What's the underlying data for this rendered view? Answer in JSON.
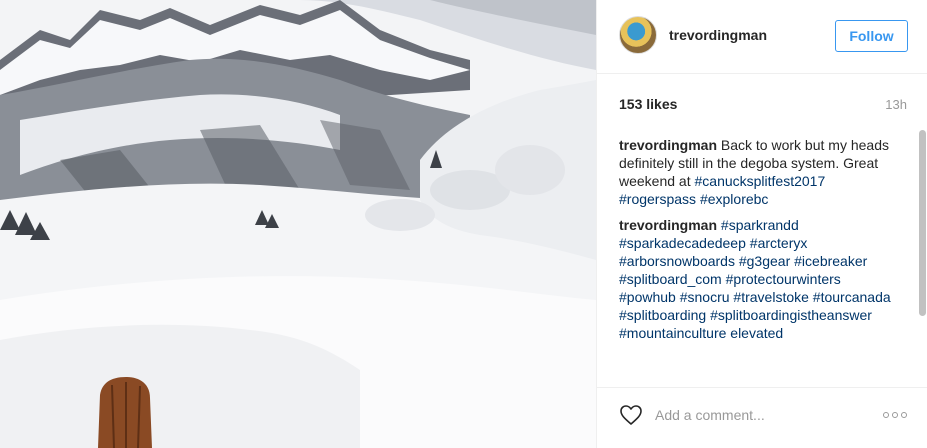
{
  "post": {
    "photo_alt": "",
    "author": {
      "username": "trevordingman",
      "avatar_icon": "avatar"
    },
    "follow_label": "Follow",
    "likes": "153 likes",
    "time_ago": "13h",
    "comments": [
      {
        "user": "trevordingman",
        "parts": [
          {
            "type": "text",
            "value": "Back to work but my heads definitely still in the degoba system. Great weekend at "
          },
          {
            "type": "tag",
            "value": "#canucksplitfest2017"
          },
          {
            "type": "text",
            "value": " "
          },
          {
            "type": "tag",
            "value": "#rogerspass"
          },
          {
            "type": "text",
            "value": " "
          },
          {
            "type": "tag",
            "value": "#explorebc"
          }
        ]
      },
      {
        "user": "trevordingman",
        "parts": [
          {
            "type": "tag",
            "value": "#sparkrandd"
          },
          {
            "type": "text",
            "value": " "
          },
          {
            "type": "tag",
            "value": "#sparkadecadedeep"
          },
          {
            "type": "text",
            "value": " "
          },
          {
            "type": "tag",
            "value": "#arcteryx"
          },
          {
            "type": "text",
            "value": " "
          },
          {
            "type": "tag",
            "value": "#arborsnowboards"
          },
          {
            "type": "text",
            "value": " "
          },
          {
            "type": "tag",
            "value": "#g3gear"
          },
          {
            "type": "text",
            "value": " "
          },
          {
            "type": "tag",
            "value": "#icebreaker"
          },
          {
            "type": "text",
            "value": " "
          },
          {
            "type": "tag",
            "value": "#splitboard_com"
          },
          {
            "type": "text",
            "value": " "
          },
          {
            "type": "tag",
            "value": "#protectourwinters"
          },
          {
            "type": "text",
            "value": " "
          },
          {
            "type": "tag",
            "value": "#powhub"
          },
          {
            "type": "text",
            "value": " "
          },
          {
            "type": "tag",
            "value": "#snocru"
          },
          {
            "type": "text",
            "value": " "
          },
          {
            "type": "tag",
            "value": "#travelstoke"
          },
          {
            "type": "text",
            "value": " "
          },
          {
            "type": "tag",
            "value": "#tourcanada"
          },
          {
            "type": "text",
            "value": " "
          },
          {
            "type": "tag",
            "value": "#splitboarding"
          },
          {
            "type": "text",
            "value": " "
          },
          {
            "type": "tag",
            "value": "#splitboardingistheanswer"
          },
          {
            "type": "text",
            "value": " "
          },
          {
            "type": "tag",
            "value": "#mountainculture elevated"
          }
        ]
      }
    ],
    "comment_placeholder": "Add a comment...",
    "icons": {
      "like": "heart-icon",
      "more": "more-options-icon"
    },
    "colors": {
      "accent": "#3897f0",
      "hashtag": "#003569",
      "muted": "#999999",
      "text": "#262626"
    }
  }
}
